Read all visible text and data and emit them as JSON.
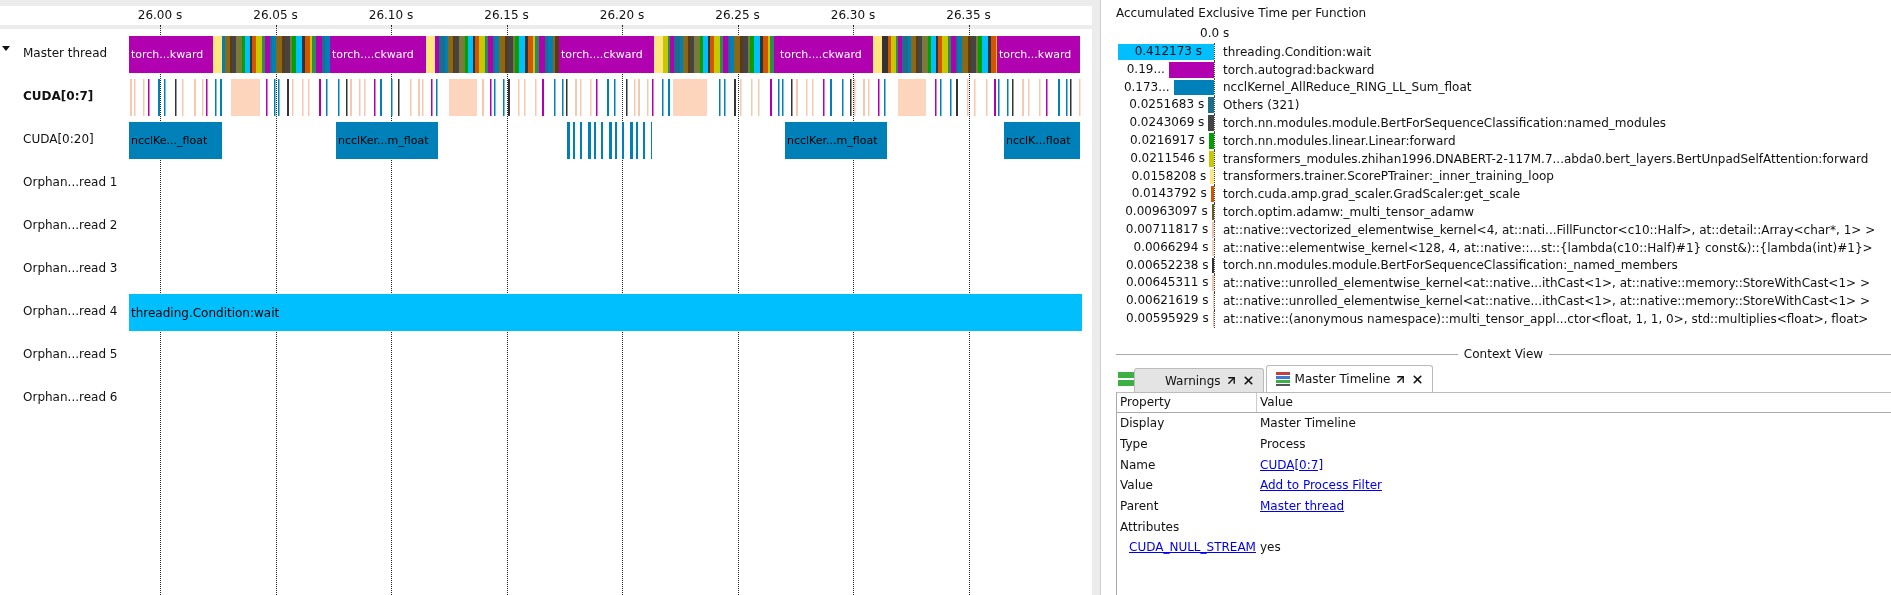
{
  "timeline": {
    "ticks": [
      "26.00 s",
      "26.05 s",
      "26.10 s",
      "26.15 s",
      "26.20 s",
      "26.25 s",
      "26.30 s",
      "26.35 s"
    ],
    "rows": [
      {
        "label": "Master thread",
        "kind": "master",
        "selected": false,
        "expanded": true,
        "blocks": [
          "torch...kward",
          "torch....ckward",
          "torch....ckward",
          "torch....ckward",
          "torch...kward"
        ]
      },
      {
        "label": "CUDA[0:7]",
        "kind": "events",
        "selected": true
      },
      {
        "label": "CUDA[0:20]",
        "kind": "kernels",
        "selected": false,
        "blocks": [
          "ncclKe..._float",
          "ncclKer...m_float",
          "ncclKer...m_float",
          "ncclK...float"
        ]
      },
      {
        "label": "Orphan...read 1",
        "kind": "empty",
        "selected": false
      },
      {
        "label": "Orphan...read 2",
        "kind": "empty",
        "selected": false
      },
      {
        "label": "Orphan...read 3",
        "kind": "empty",
        "selected": false
      },
      {
        "label": "Orphan...read 4",
        "kind": "wait",
        "selected": false,
        "blocks": [
          "threading.Condition:wait"
        ]
      },
      {
        "label": "Orphan...read 5",
        "kind": "empty",
        "selected": false
      },
      {
        "label": "Orphan...read 6",
        "kind": "empty",
        "selected": false
      }
    ]
  },
  "function_summary": {
    "title": "Accumulated Exclusive Time per Function",
    "axis_label": "0.0 s",
    "rows": [
      {
        "value": "0.412173 s",
        "name": "threading.Condition:wait",
        "level": 1,
        "color": "#00bfff"
      },
      {
        "value": "0.19...",
        "name": "torch.autograd:backward",
        "level": 0.47,
        "color": "#b000b0"
      },
      {
        "value": "0.173...",
        "name": "ncclKernel_AllReduce_RING_LL_Sum_float",
        "level": 0.42,
        "color": "#0080b8"
      },
      {
        "value": "0.0251683 s",
        "name": "Others (321)",
        "level": 0.061,
        "color": "#1b6f8c"
      },
      {
        "value": "0.0243069 s",
        "name": "torch.nn.modules.module.BertForSequenceClassification:named_modules",
        "level": 0.059,
        "color": "#444444"
      },
      {
        "value": "0.0216917 s",
        "name": "torch.nn.modules.linear.Linear:forward",
        "level": 0.053,
        "color": "#00a000"
      },
      {
        "value": "0.0211546 s",
        "name": "transformers_modules.zhihan1996.DNABERT-2-117M.7...abda0.bert_layers.BertUnpadSelfAttention:forward",
        "level": 0.051,
        "color": "#c8c800"
      },
      {
        "value": "0.0158208 s",
        "name": "transformers.trainer.ScorePTrainer:_inner_training_loop",
        "level": 0.038,
        "color": "#ffe680"
      },
      {
        "value": "0.0143792 s",
        "name": "torch.cuda.amp.grad_scaler.GradScaler:get_scale",
        "level": 0.035,
        "color": "#d45500"
      },
      {
        "value": "0.00963097 s",
        "name": "torch.optim.adamw:_multi_tensor_adamw",
        "level": 0.023,
        "color": "#6b5a1e"
      },
      {
        "value": "0.00711817 s",
        "name": "at::native::vectorized_elementwise_kernel<4, at::nati...FillFunctor<c10::Half>, at::detail::Array<char*, 1> >",
        "level": 0.017,
        "color": "#f0c0a8"
      },
      {
        "value": "0.0066294 s",
        "name": "at::native::elementwise_kernel<128, 4, at::native::...st::{lambda(c10::Half)#1} const&)::{lambda(int)#1}>",
        "level": 0.016,
        "color": "#f5d0b8"
      },
      {
        "value": "0.00652238 s",
        "name": "torch.nn.modules.module.BertForSequenceClassification:_named_members",
        "level": 0.016,
        "color": "#333333"
      },
      {
        "value": "0.00645311 s",
        "name": "at::native::unrolled_elementwise_kernel<at::native...ithCast<1>, at::native::memory::StoreWithCast<1> >",
        "level": 0.016,
        "color": "#f2c4ac"
      },
      {
        "value": "0.00621619 s",
        "name": "at::native::unrolled_elementwise_kernel<at::native...ithCast<1>, at::native::memory::StoreWithCast<1> >",
        "level": 0.015,
        "color": "#f5c8b0"
      },
      {
        "value": "0.00595929 s",
        "name": "at::native::(anonymous namespace)::multi_tensor_appl...ctor<float, 1, 1, 0>, std::multiplies<float>, float>",
        "level": 0.014,
        "color": "#e8b8a0"
      }
    ]
  },
  "context_view": {
    "title": "Context View",
    "tabs": [
      {
        "label": "Warnings",
        "selected": false
      },
      {
        "label": "Master Timeline",
        "selected": true
      }
    ],
    "columns": [
      "Property",
      "Value"
    ],
    "rows": [
      {
        "property": "Display",
        "value": "Master Timeline",
        "link": false
      },
      {
        "property": "Type",
        "value": "Process",
        "link": false
      },
      {
        "property": "Name",
        "value": "CUDA[0:7]",
        "link": true
      },
      {
        "property": "Value",
        "value": "Add to Process Filter",
        "link": true
      },
      {
        "property": "Parent",
        "value": "Master thread",
        "link": true
      },
      {
        "property": "Attributes",
        "children": [
          {
            "property": "CUDA_NULL_STREAM",
            "value": "yes",
            "link": false
          }
        ]
      }
    ]
  }
}
